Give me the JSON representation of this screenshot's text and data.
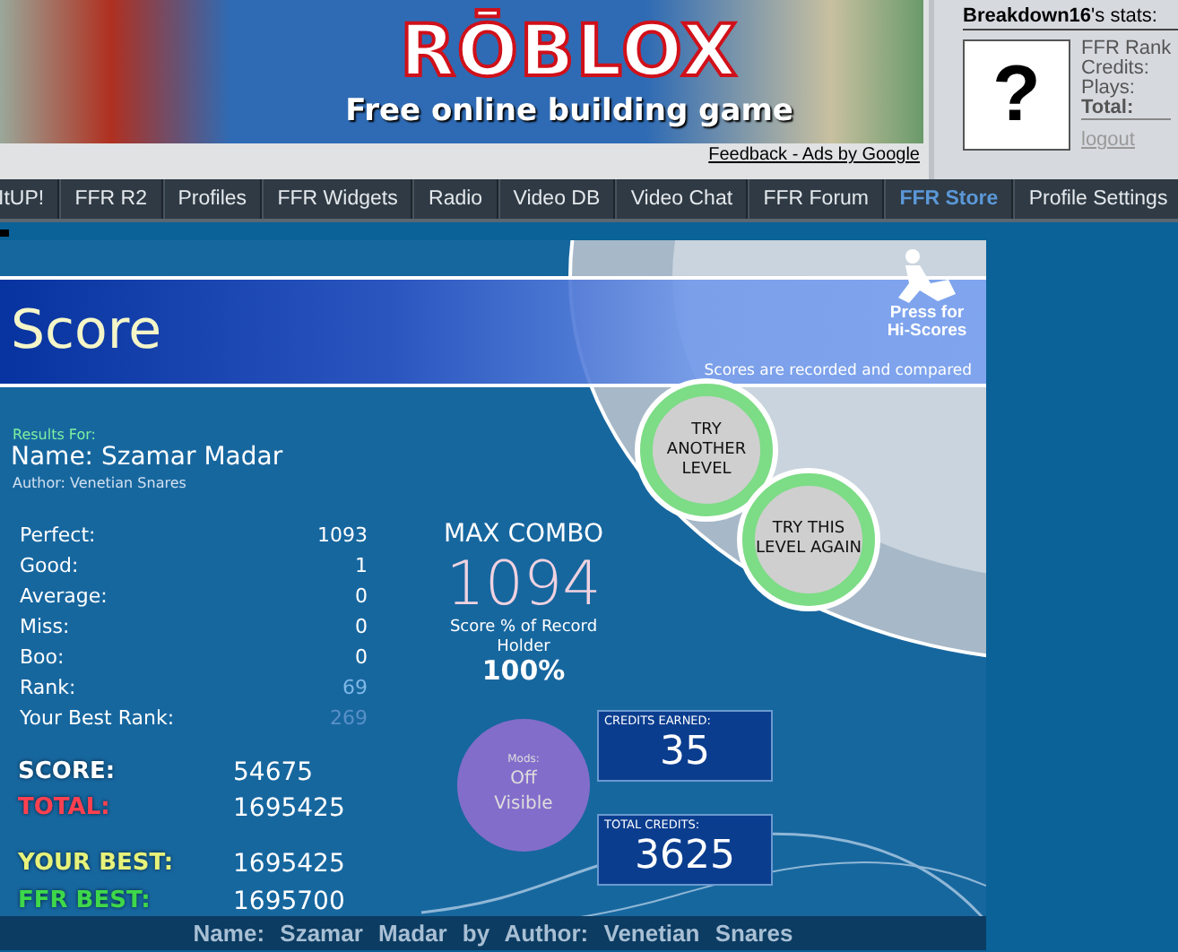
{
  "ad": {
    "logo": "RŌBLOX",
    "tagline": "Free online building game",
    "feedback_link": "Feedback - Ads by Google"
  },
  "user_stats": {
    "title": "**Breakdown16**'s stats:",
    "avatar_glyph": "?",
    "labels": [
      {
        "text": "FFR Rank",
        "bold": false
      },
      {
        "text": "Credits:",
        "bold": false
      },
      {
        "text": "Plays:",
        "bold": false
      },
      {
        "text": "Total:",
        "bold": true
      }
    ],
    "logout": "logout"
  },
  "nav": [
    {
      "label": "ItUP!",
      "selected": false
    },
    {
      "label": "FFR R2",
      "selected": false
    },
    {
      "label": "Profiles",
      "selected": false
    },
    {
      "label": "FFR Widgets",
      "selected": false
    },
    {
      "label": "Radio",
      "selected": false
    },
    {
      "label": "Video DB",
      "selected": false
    },
    {
      "label": "Video Chat",
      "selected": false
    },
    {
      "label": "FFR Forum",
      "selected": false
    },
    {
      "label": "FFR Store",
      "selected": true
    },
    {
      "label": "Profile Settings",
      "selected": false
    }
  ],
  "game": {
    "title": "Score",
    "hiscores": [
      "Press for",
      "Hi-Scores"
    ],
    "recorded_note": "Scores are recorded and compared",
    "buttons": [
      "TRY ANOTHER LEVEL",
      "TRY THIS LEVEL AGAIN"
    ],
    "results_for": "Results For:",
    "name": "Name: Szamar Madar",
    "author": "Author: Venetian Snares",
    "judgements": [
      {
        "label": "Perfect:",
        "value": "1093",
        "kind": "count"
      },
      {
        "label": "Good:",
        "value": "1",
        "kind": "count"
      },
      {
        "label": "Average:",
        "value": "0",
        "kind": "count"
      },
      {
        "label": "Miss:",
        "value": "0",
        "kind": "count"
      },
      {
        "label": "Boo:",
        "value": "0",
        "kind": "count"
      },
      {
        "label": "Rank:",
        "value": "69",
        "kind": "rank"
      },
      {
        "label": "Your Best Rank:",
        "value": "269",
        "kind": "best_rank"
      }
    ],
    "max_combo": {
      "label": "MAX COMBO",
      "value": "1094"
    },
    "record": {
      "label": "Score % of Record Holder",
      "value": "100%"
    },
    "totals": [
      {
        "label": "SCORE:",
        "value": "54675",
        "color": "#ffffff"
      },
      {
        "label": "TOTAL:",
        "value": "1695425",
        "color": "#ff4050"
      },
      {
        "label": "YOUR BEST:",
        "value": "1695425",
        "color": "#e6f27a"
      },
      {
        "label": "FFR BEST:",
        "value": "1695700",
        "color": "#3ed84a"
      }
    ],
    "mods": {
      "label": "Mods:",
      "value": "Off",
      "visibility": "Visible"
    },
    "credits": [
      {
        "label": "CREDITS EARNED:",
        "value": "35"
      },
      {
        "label": "TOTAL CREDITS:",
        "value": "3625"
      }
    ],
    "footer": "Name: Szamar Madar by Author: Venetian Snares"
  }
}
